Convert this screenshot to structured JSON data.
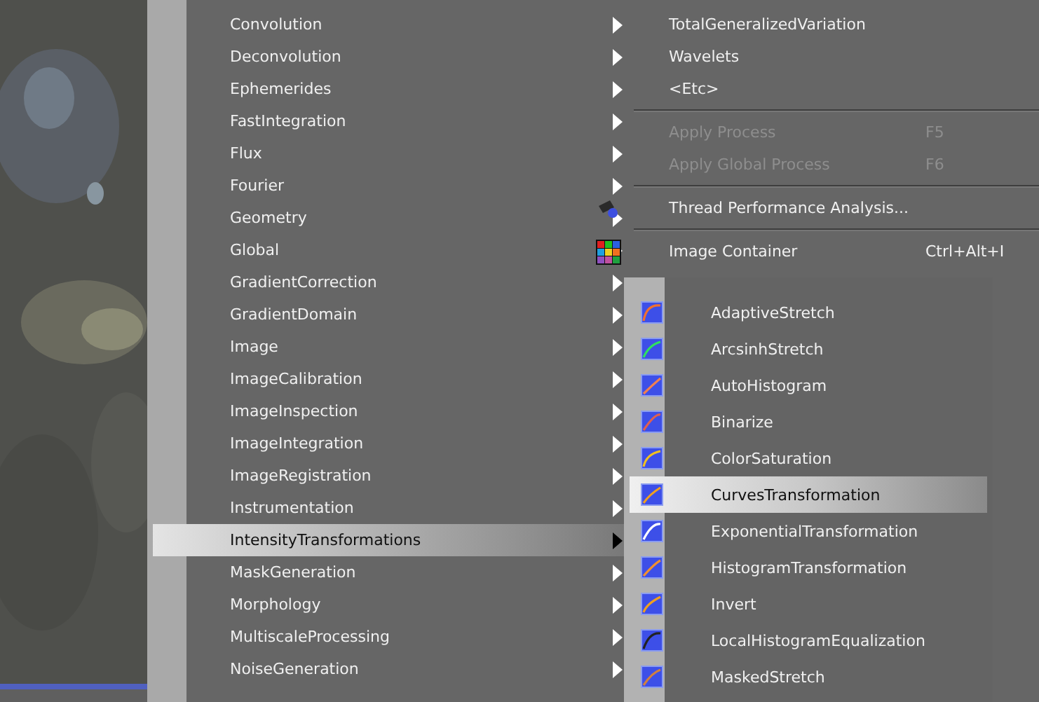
{
  "process_menu": {
    "items": [
      {
        "label": "Convolution",
        "selected": false
      },
      {
        "label": "Deconvolution",
        "selected": false
      },
      {
        "label": "Ephemerides",
        "selected": false
      },
      {
        "label": "FastIntegration",
        "selected": false
      },
      {
        "label": "Flux",
        "selected": false
      },
      {
        "label": "Fourier",
        "selected": false
      },
      {
        "label": "Geometry",
        "selected": false
      },
      {
        "label": "Global",
        "selected": false
      },
      {
        "label": "GradientCorrection",
        "selected": false
      },
      {
        "label": "GradientDomain",
        "selected": false
      },
      {
        "label": "Image",
        "selected": false
      },
      {
        "label": "ImageCalibration",
        "selected": false
      },
      {
        "label": "ImageInspection",
        "selected": false
      },
      {
        "label": "ImageIntegration",
        "selected": false
      },
      {
        "label": "ImageRegistration",
        "selected": false
      },
      {
        "label": "Instrumentation",
        "selected": false
      },
      {
        "label": "IntensityTransformations",
        "selected": true
      },
      {
        "label": "MaskGeneration",
        "selected": false
      },
      {
        "label": "Morphology",
        "selected": false
      },
      {
        "label": "MultiscaleProcessing",
        "selected": false
      },
      {
        "label": "NoiseGeneration",
        "selected": false
      }
    ]
  },
  "main_menu": {
    "items": [
      {
        "kind": "item",
        "label": "TotalGeneralizedVariation",
        "disabled": false
      },
      {
        "kind": "item",
        "label": "Wavelets",
        "disabled": false
      },
      {
        "kind": "item",
        "label": "<Etc>",
        "disabled": false
      },
      {
        "kind": "separator"
      },
      {
        "kind": "item",
        "label": "Apply Process",
        "shortcut": "F5",
        "disabled": true
      },
      {
        "kind": "item",
        "label": "Apply Global Process",
        "shortcut": "F6",
        "disabled": true
      },
      {
        "kind": "separator"
      },
      {
        "kind": "tool",
        "label": "Thread Performance Analysis...",
        "disabled": false
      },
      {
        "kind": "separator"
      },
      {
        "kind": "container",
        "label": "Image Container",
        "shortcut": "Ctrl+Alt+I",
        "disabled": false
      }
    ]
  },
  "submenu": {
    "items": [
      {
        "label": "AdaptiveStretch",
        "selected": false
      },
      {
        "label": "ArcsinhStretch",
        "selected": false
      },
      {
        "label": "AutoHistogram",
        "selected": false
      },
      {
        "label": "Binarize",
        "selected": false
      },
      {
        "label": "ColorSaturation",
        "selected": false
      },
      {
        "label": "CurvesTransformation",
        "selected": true
      },
      {
        "label": "ExponentialTransformation",
        "selected": false
      },
      {
        "label": "HistogramTransformation",
        "selected": false
      },
      {
        "label": "Invert",
        "selected": false
      },
      {
        "label": "LocalHistogramEqualization",
        "selected": false
      },
      {
        "label": "MaskedStretch",
        "selected": false
      }
    ]
  }
}
